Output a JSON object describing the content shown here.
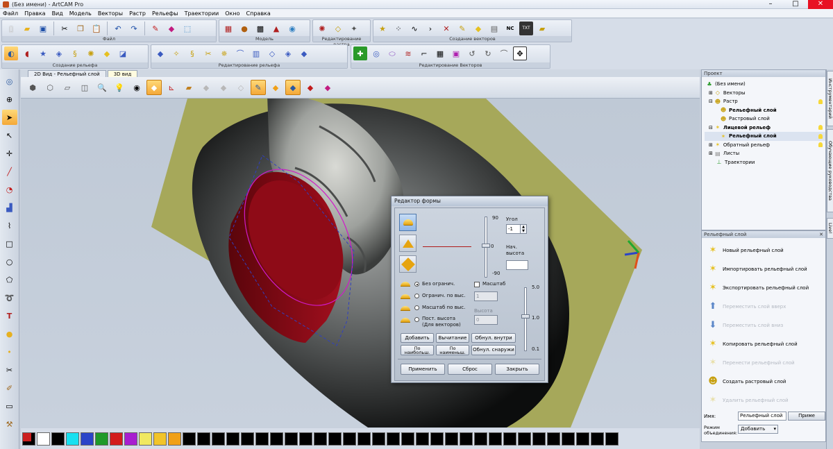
{
  "window": {
    "title": "(Без имени) - ArtCAM Pro"
  },
  "menu": [
    "Файл",
    "Правка",
    "Вид",
    "Модель",
    "Векторы",
    "Растр",
    "Рельефы",
    "Траектории",
    "Окно",
    "Справка"
  ],
  "toolbars": {
    "file_caption": "Файл",
    "model_caption": "Модель",
    "raster_caption": "Редактирование растра",
    "vector_create_caption": "Создание векторов",
    "relief_create_caption": "Создание рельефа",
    "relief_edit_caption": "Редактирование рельефа",
    "vector_edit_caption": "Редактирование Векторов"
  },
  "doc_tabs": [
    "2D Вид - Рельефный слой",
    "3D вид"
  ],
  "project_panel": {
    "title": "Проект",
    "items": [
      {
        "label": "(Без имени)",
        "icon": "project-icon",
        "bold": false
      },
      {
        "label": "Векторы",
        "icon": "vectors-icon",
        "bold": false
      },
      {
        "label": "Растр",
        "icon": "raster-icon",
        "bold": false
      },
      {
        "label": "Рельефный слой",
        "icon": "relief-layer-icon",
        "bold": true
      },
      {
        "label": "Растровый слой",
        "icon": "raster-layer-icon",
        "bold": false
      },
      {
        "label": "Лицевой рельеф",
        "icon": "front-relief-icon",
        "bold": true
      },
      {
        "label": "Рельефный слой",
        "icon": "relief-layer-icon",
        "bold": true
      },
      {
        "label": "Обратный рельеф",
        "icon": "back-relief-icon",
        "bold": false
      },
      {
        "label": "Листы",
        "icon": "sheets-icon",
        "bold": false
      },
      {
        "label": "Траектории",
        "icon": "toolpaths-icon",
        "bold": false
      }
    ]
  },
  "relief_panel": {
    "title": "Рельефный слой",
    "tasks": [
      {
        "label": "Новый рельефный слой",
        "enabled": true
      },
      {
        "label": "Импортировать рельефный слой",
        "enabled": true
      },
      {
        "label": "Экспортировать рельефный слой",
        "enabled": true
      },
      {
        "label": "Переместить слой вверх",
        "enabled": false
      },
      {
        "label": "Переместить слой вниз",
        "enabled": false
      },
      {
        "label": "Копировать рельефный слой",
        "enabled": true
      },
      {
        "label": "Перенести рельефный слой",
        "enabled": false
      },
      {
        "label": "Создать растровый слой",
        "enabled": true
      },
      {
        "label": "Удалить рельефный слой",
        "enabled": false
      }
    ],
    "name_label": "Имя:",
    "name_value": "Рельефный слой",
    "apply_label": "Приме",
    "merge_label1": "Режим",
    "merge_label2": "объединения:",
    "merge_value": "Добавить"
  },
  "side_tabs": [
    "Инструментарий",
    "Обучающие руководства",
    "Live!"
  ],
  "dialog": {
    "title": "Редактор формы",
    "angle_label": "Угол",
    "angle_value": "-1",
    "start_height_label1": "Нач.",
    "start_height_label2": "высота",
    "start_height_value": "",
    "slider_top": "90",
    "slider_mid": "0",
    "slider_bottom": "-90",
    "scale_top": "5.0",
    "scale_mid": "1.0",
    "scale_bottom": "0.1",
    "opt_unlimited": "Без огранич.",
    "opt_limit_height": "Огранич. по выс.",
    "opt_scale_height": "Масштаб по выс.",
    "opt_const_height1": "Пост. высота",
    "opt_const_height2": "(Для векторов)",
    "scale_check": "Масштаб",
    "scale_value": "1",
    "height_label": "Высота",
    "height_value": "0",
    "btn_add": "Добавить",
    "btn_subtract": "Вычитание",
    "btn_zero_inside": "Обнул. внутри",
    "btn_highest1": "По",
    "btn_highest2": "наибольш.",
    "btn_lowest1": "По",
    "btn_lowest2": "наименьш.",
    "btn_zero_outside": "Обнул. снаружи",
    "btn_apply": "Применить",
    "btn_reset": "Сброс",
    "btn_close": "Закрыть"
  },
  "palette": [
    "#cc1f1f",
    "#ffffff",
    "#000000",
    "#18e0f0",
    "#2a44c8",
    "#1f9a2a",
    "#d21c1c",
    "#a81ed0",
    "#f0e860",
    "#f2c42a",
    "#f0a018",
    "#000000",
    "#000000",
    "#000000",
    "#000000",
    "#000000",
    "#000000",
    "#000000",
    "#000000",
    "#000000",
    "#000000",
    "#000000",
    "#000000",
    "#000000",
    "#000000",
    "#000000",
    "#000000",
    "#000000",
    "#000000",
    "#000000",
    "#000000",
    "#000000",
    "#000000",
    "#000000",
    "#000000",
    "#000000",
    "#000000",
    "#000000",
    "#000000",
    "#000000",
    "#000000"
  ],
  "colors": {
    "accent_relief": "#9b0a18",
    "base_plate": "#a6a85a"
  }
}
